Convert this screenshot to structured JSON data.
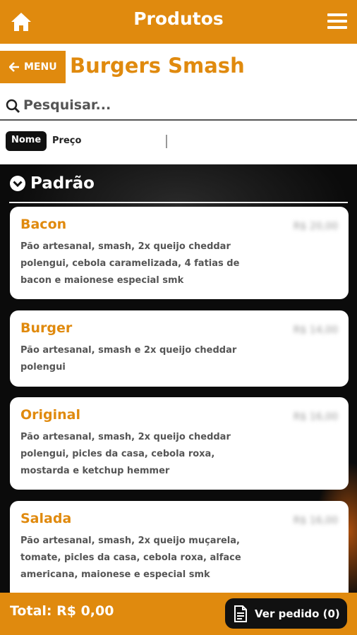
{
  "header": {
    "title": "Produtos",
    "home_icon": "home-icon",
    "menu_icon": "hamburger-menu-icon"
  },
  "category": {
    "back_label": "MENU",
    "title": "Burgers Smash"
  },
  "search": {
    "placeholder": "Pesquisar..."
  },
  "sort": {
    "active": "Nome",
    "other": "Preço"
  },
  "section": {
    "title": "Padrão"
  },
  "products": [
    {
      "name": "Bacon",
      "price": "R$ 20,00",
      "description": "Pão artesanal, smash, 2x queijo cheddar polengui, cebola caramelizada, 4 fatias de bacon e maionese especial smk"
    },
    {
      "name": "Burger",
      "price": "R$ 14,00",
      "description": "Pão artesanal, smash e 2x queijo cheddar polengui"
    },
    {
      "name": "Original",
      "price": "R$ 16,00",
      "description": "Pão artesanal, smash, 2x queijo cheddar polengui, picles da casa, cebola roxa, mostarda e ketchup hemmer"
    },
    {
      "name": "Salada",
      "price": "R$ 16,00",
      "description": "Pão artesanal, smash, 2x queijo muçarela, tomate, picles da casa, cebola roxa, alface americana, maionese e especial smk"
    }
  ],
  "footer": {
    "total": "Total: R$ 0,00",
    "order_button": "Ver pedido (0)"
  },
  "colors": {
    "accent": "#E08A0E",
    "dark": "#111111"
  }
}
